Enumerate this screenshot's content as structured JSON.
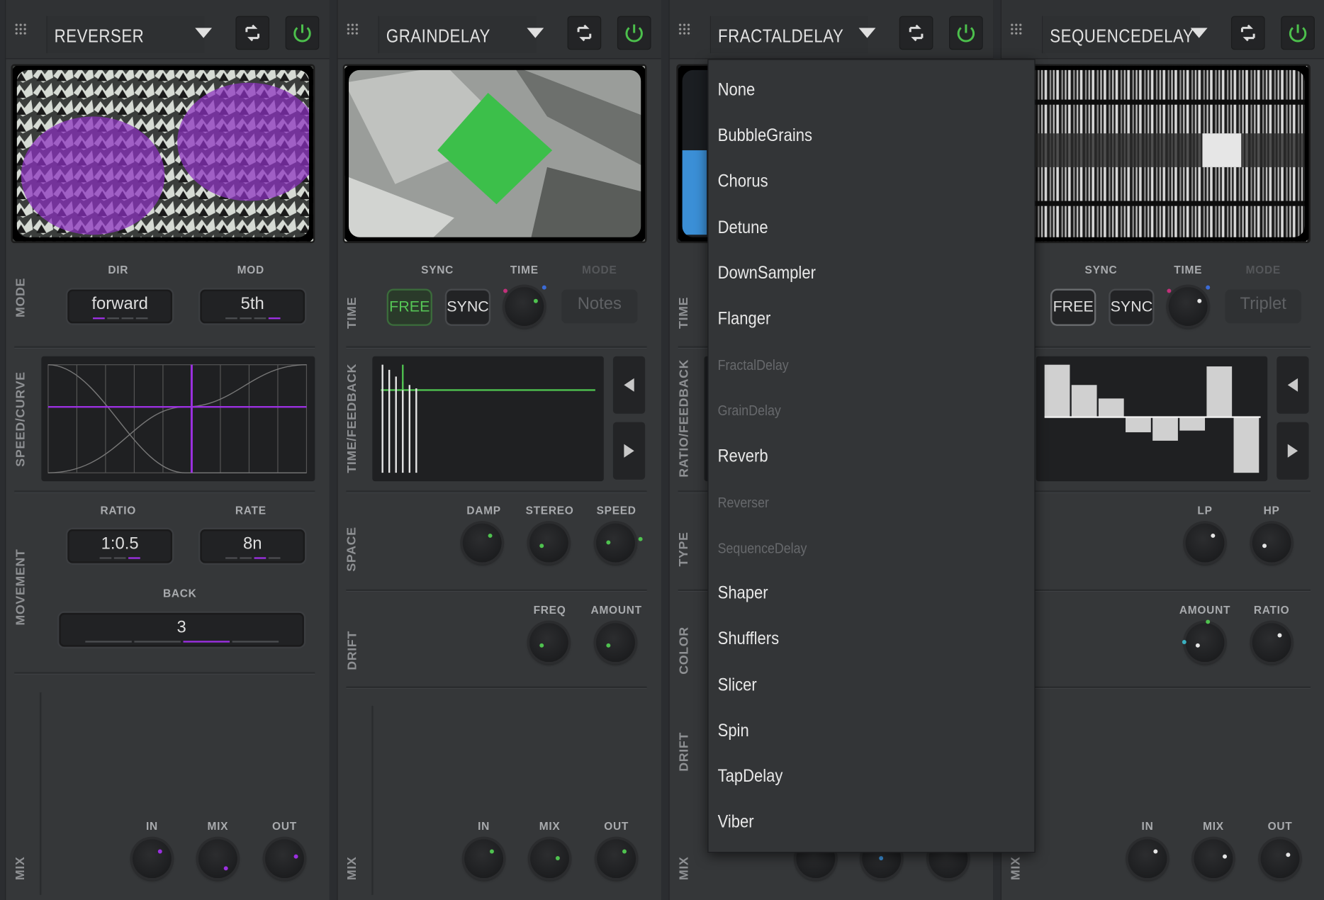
{
  "plugins": [
    {
      "name": "REVERSER",
      "mode_label": "MODE",
      "dir_label": "DIR",
      "dir_value": "forward",
      "mod_label": "MOD",
      "mod_value": "5th",
      "curve_label": "SPEED/CURVE",
      "movement_label": "MOVEMENT",
      "ratio_label": "RATIO",
      "ratio_value": "1:0.5",
      "rate_label": "RATE",
      "rate_value": "8n",
      "back_label": "BACK",
      "back_value": "3",
      "mix_label": "MIX",
      "in_label": "IN",
      "mixk_label": "MIX",
      "out_label": "OUT",
      "accent": "#9b30e0"
    },
    {
      "name": "GRAINDELAY",
      "time_label": "TIME",
      "sync_label": "SYNC",
      "free_btn": "FREE",
      "sync_btn": "SYNC",
      "timek_label": "TIME",
      "mode_label": "MODE",
      "mode_value": "Notes",
      "tf_label": "TIME/FEEDBACK",
      "space_label": "SPACE",
      "damp_label": "DAMP",
      "stereo_label": "STEREO",
      "speed_label": "SPEED",
      "drift_label": "DRIFT",
      "freq_label": "FREQ",
      "amount_label": "AMOUNT",
      "mix_label": "MIX",
      "in_label": "IN",
      "mixk_label": "MIX",
      "out_label": "OUT",
      "accent": "#4fc24f"
    },
    {
      "name": "FRACTALDELAY",
      "time_label": "TIME",
      "rf_label": "RATIO/FEEDBACK",
      "type_label": "TYPE",
      "color_label": "COLOR",
      "drift_label": "DRIFT",
      "mix_label": "MIX",
      "accent": "#3b8fd6"
    },
    {
      "name": "SEQUENCEDELAY",
      "sync_label": "SYNC",
      "free_btn": "FREE",
      "sync_btn": "SYNC",
      "timek_label": "TIME",
      "mode_label": "MODE",
      "mode_value": "Triplet",
      "lp_label": "LP",
      "hp_label": "HP",
      "amount_label": "AMOUNT",
      "ratio_label": "RATIO",
      "mix_label": "MIX",
      "in_label": "IN",
      "mixk_label": "MIX",
      "out_label": "OUT",
      "accent": "#e8e8e8"
    }
  ],
  "dropdown": {
    "items": [
      {
        "label": "None",
        "enabled": true
      },
      {
        "label": "BubbleGrains",
        "enabled": true
      },
      {
        "label": "Chorus",
        "enabled": true
      },
      {
        "label": "Detune",
        "enabled": true
      },
      {
        "label": "DownSampler",
        "enabled": true
      },
      {
        "label": "Flanger",
        "enabled": true
      },
      {
        "label": "FractalDelay",
        "enabled": false
      },
      {
        "label": "GrainDelay",
        "enabled": false
      },
      {
        "label": "Reverb",
        "enabled": true
      },
      {
        "label": "Reverser",
        "enabled": false
      },
      {
        "label": "SequenceDelay",
        "enabled": false
      },
      {
        "label": "Shaper",
        "enabled": true
      },
      {
        "label": "Shufflers",
        "enabled": true
      },
      {
        "label": "Slicer",
        "enabled": true
      },
      {
        "label": "Spin",
        "enabled": true
      },
      {
        "label": "TapDelay",
        "enabled": true
      },
      {
        "label": "Viber",
        "enabled": true
      }
    ]
  },
  "icons": {
    "grip": "drag-handle-icon",
    "caret": "chevron-down-icon",
    "expand": "expand-icon",
    "power": "power-icon",
    "left": "arrow-left-icon",
    "right": "arrow-right-icon"
  },
  "colors": {
    "power_on": "#4cc04c",
    "reverser_purple": "#9b30e0",
    "grain_green": "#4fc24f"
  }
}
